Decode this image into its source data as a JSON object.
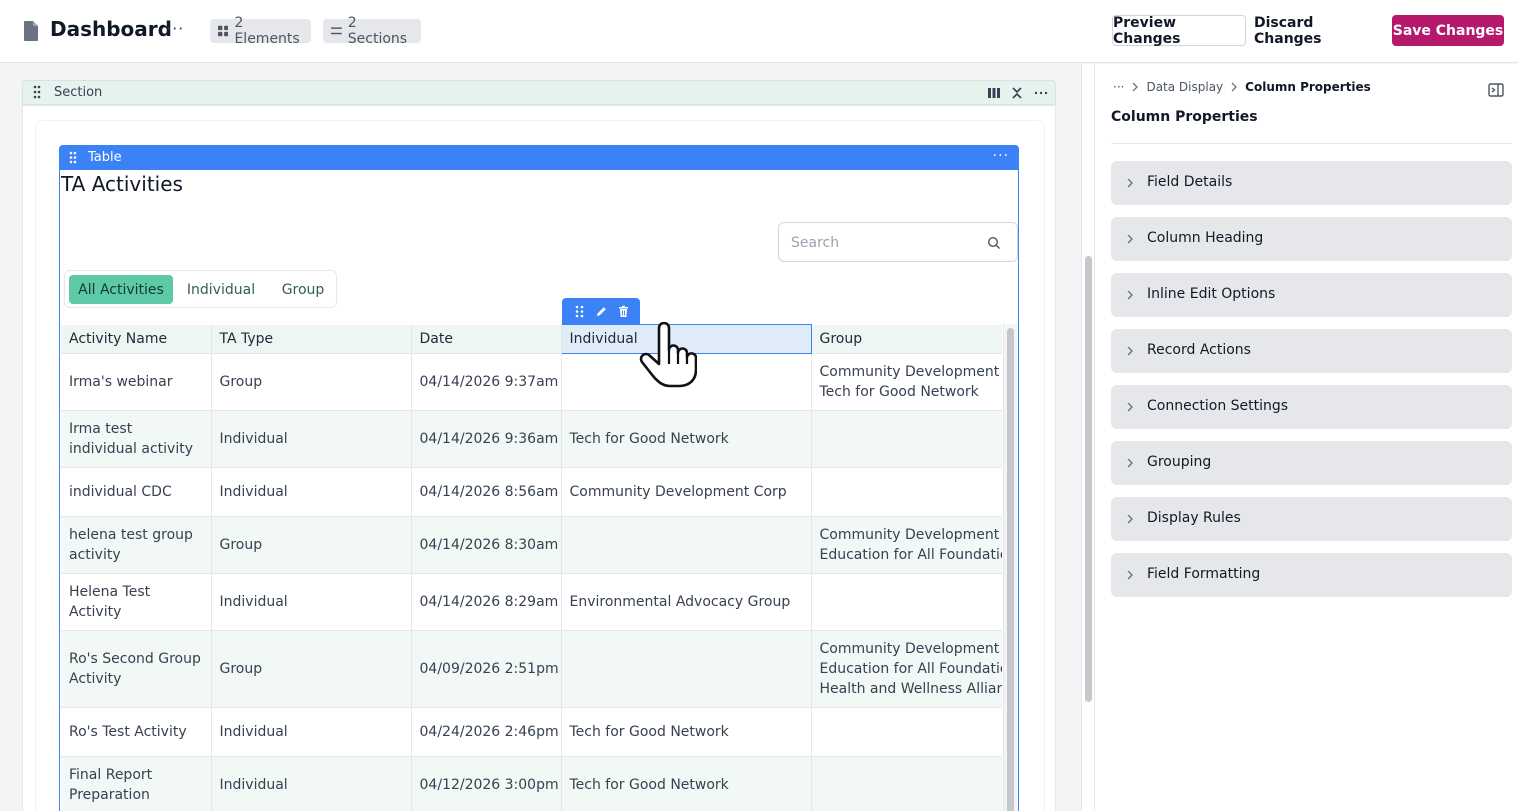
{
  "header": {
    "title": "Dashboard",
    "more": "···",
    "elements_count": "2 Elements",
    "sections_count": "2 Sections",
    "preview_label": "Preview Changes",
    "discard_label": "Discard Changes",
    "save_label": "Save Changes"
  },
  "section": {
    "label": "Section"
  },
  "table_widget": {
    "label": "Table",
    "title": "TA Activities",
    "search_placeholder": "Search",
    "tabs": [
      {
        "label": "All Activities",
        "active": true
      },
      {
        "label": "Individual",
        "active": false
      },
      {
        "label": "Group",
        "active": false
      }
    ],
    "columns": [
      "Activity Name",
      "TA Type",
      "Date",
      "Individual",
      "Group"
    ],
    "selected_column": "Individual",
    "rows": [
      {
        "name": "Irma's webinar",
        "type": "Group",
        "date": "04/14/2026 9:37am",
        "individual": "",
        "group": "Community Development Corp\nTech for Good Network"
      },
      {
        "name": "Irma test individual activity",
        "type": "Individual",
        "date": "04/14/2026 9:36am",
        "individual": "Tech for Good Network",
        "group": ""
      },
      {
        "name": "individual CDC",
        "type": "Individual",
        "date": "04/14/2026 8:56am",
        "individual": "Community Development Corp",
        "group": ""
      },
      {
        "name": "helena test group activity",
        "type": "Group",
        "date": "04/14/2026 8:30am",
        "individual": "",
        "group": "Community Development Corp\nEducation for All Foundation"
      },
      {
        "name": "Helena Test Activity",
        "type": "Individual",
        "date": "04/14/2026 8:29am",
        "individual": "Environmental Advocacy Group",
        "group": ""
      },
      {
        "name": "Ro's Second Group Activity",
        "type": "Group",
        "date": "04/09/2026 2:51pm",
        "individual": "",
        "group": "Community Development Corp\nEducation for All Foundation\nHealth and Wellness Alliance"
      },
      {
        "name": "Ro's Test Activity",
        "type": "Individual",
        "date": "04/24/2026 2:46pm",
        "individual": "Tech for Good Network",
        "group": ""
      },
      {
        "name": "Final Report Preparation",
        "type": "Individual",
        "date": "04/12/2026 3:00pm",
        "individual": "Tech for Good Network",
        "group": ""
      }
    ]
  },
  "right_panel": {
    "breadcrumb": [
      "···",
      "Data Display",
      "Column Properties"
    ],
    "title": "Column Properties",
    "sections": [
      "Field Details",
      "Column Heading",
      "Inline Edit Options",
      "Record Actions",
      "Connection Settings",
      "Grouping",
      "Display Rules",
      "Field Formatting"
    ]
  },
  "colors": {
    "accent_blue": "#3b82f6",
    "save_magenta": "#b5196b",
    "tab_active_green": "#5ec9a7"
  }
}
